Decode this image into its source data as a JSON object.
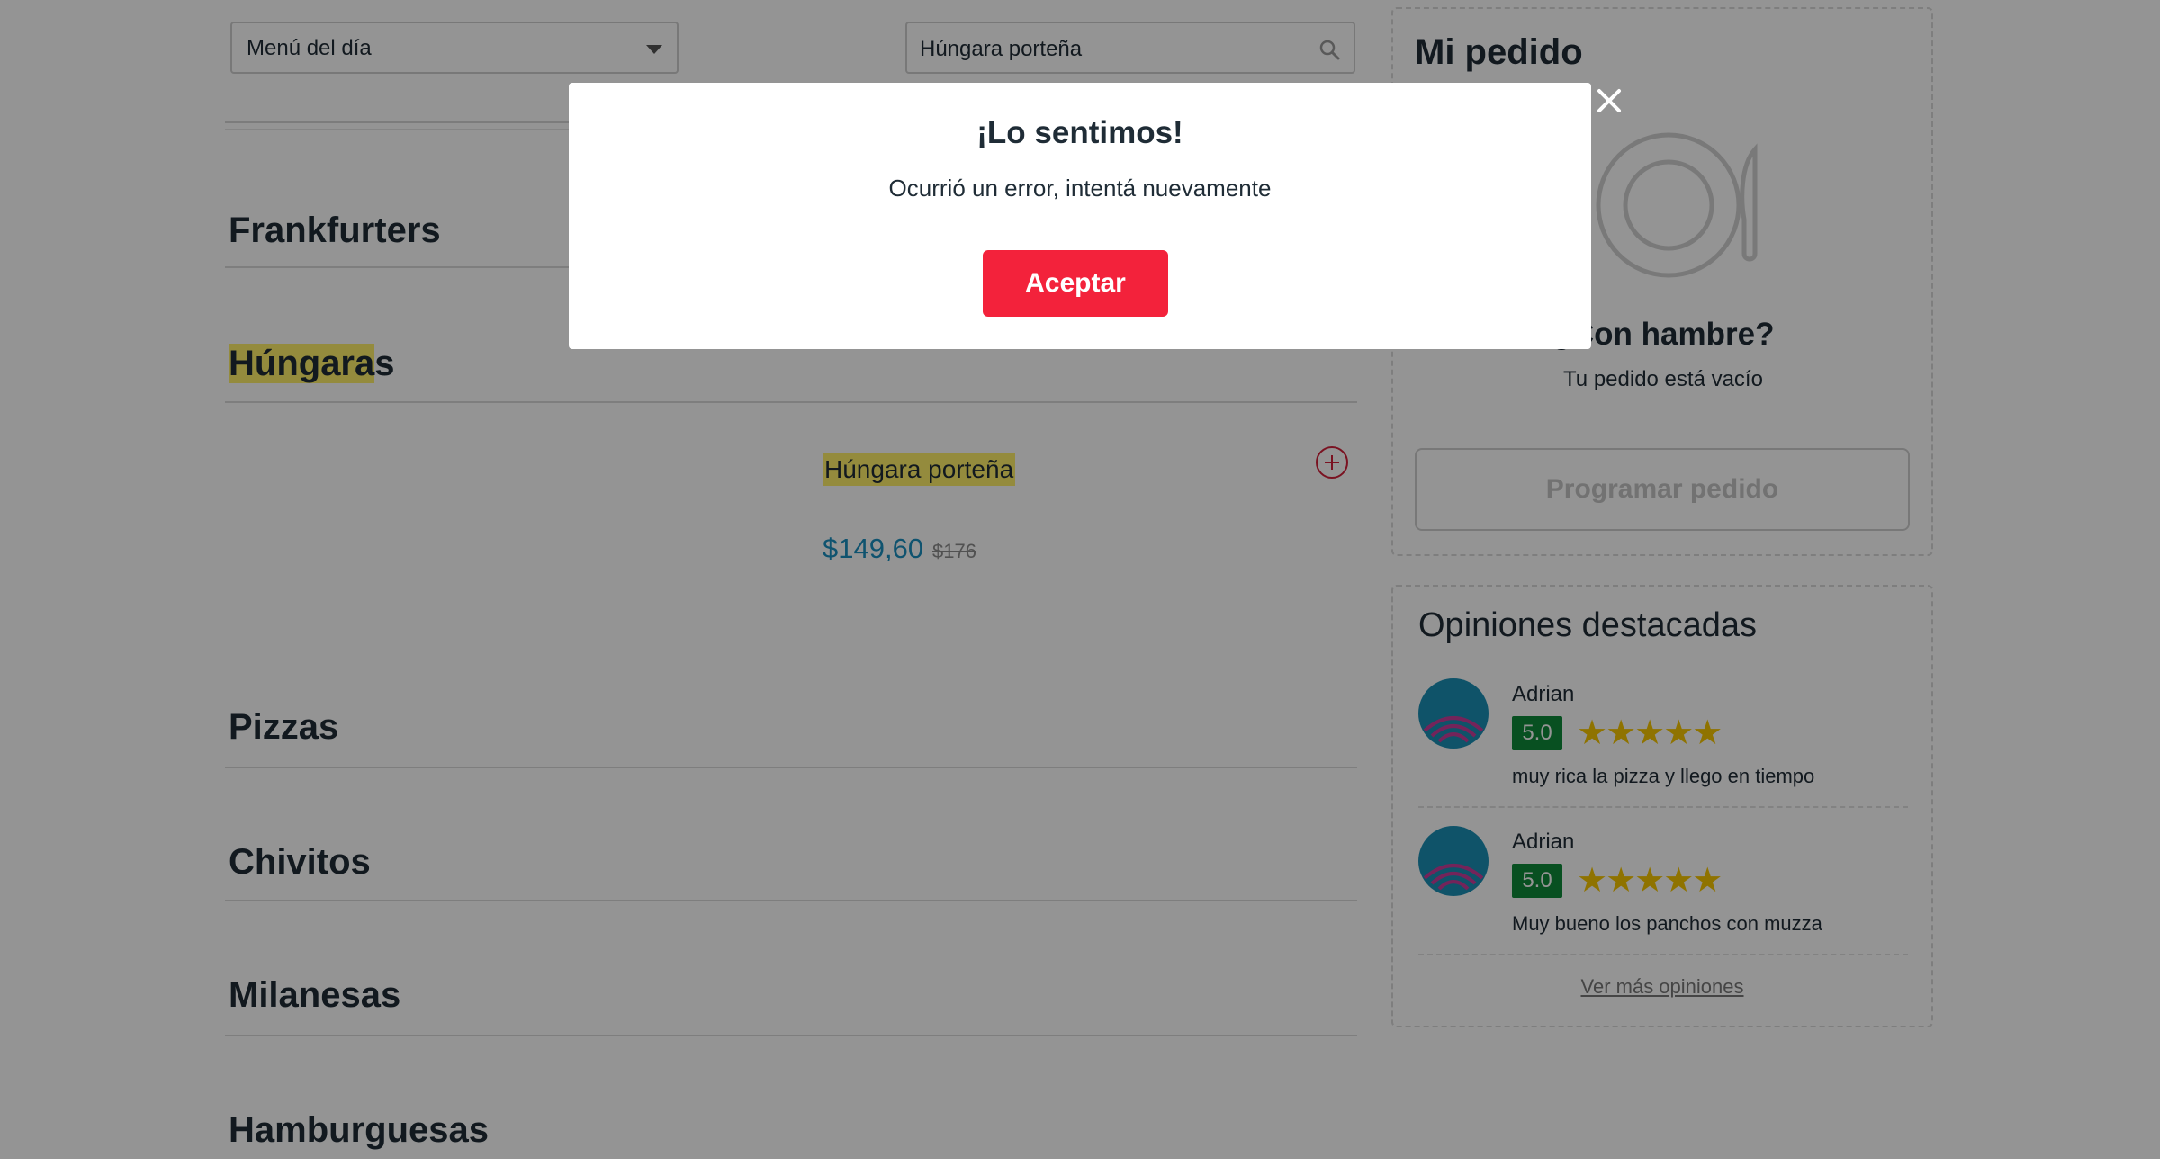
{
  "menu_filter": {
    "selected": "Menú del día"
  },
  "search": {
    "value": "Húngara porteña"
  },
  "categories": [
    {
      "label": "Frankfurters"
    },
    {
      "label_highlight": "Húngara",
      "label_rest": "s"
    },
    {
      "label": "Pizzas"
    },
    {
      "label": "Chivitos"
    },
    {
      "label": "Milanesas"
    },
    {
      "label": "Hamburguesas"
    }
  ],
  "product": {
    "name": "Húngara porteña",
    "price": "$149,60",
    "old_price": "$176"
  },
  "order": {
    "title": "Mi pedido",
    "hungry": "¿Con hambre?",
    "empty": "Tu pedido está vacío",
    "schedule_label": "Programar pedido"
  },
  "reviews": {
    "title": "Opiniones destacadas",
    "items": [
      {
        "name": "Adrian",
        "score": "5.0",
        "stars": 5,
        "text": "muy rica la pizza y llego en tiempo"
      },
      {
        "name": "Adrian",
        "score": "5.0",
        "stars": 5,
        "text": "Muy bueno los panchos con muzza"
      }
    ],
    "more_label": "Ver más opiniones"
  },
  "modal": {
    "title": "¡Lo sentimos!",
    "message": "Ocurrió un error, intentá nuevamente",
    "accept_label": "Aceptar"
  },
  "colors": {
    "accent_red": "#f3223b",
    "price_blue": "#1a8fc0",
    "highlight": "#fff06a",
    "badge_green": "#0f8a3a",
    "star_yellow": "#f6c600"
  },
  "icons": [
    "search-icon",
    "chevron-down-icon",
    "add-icon",
    "plate-icon",
    "star-icon",
    "close-icon",
    "avatar-icon"
  ]
}
